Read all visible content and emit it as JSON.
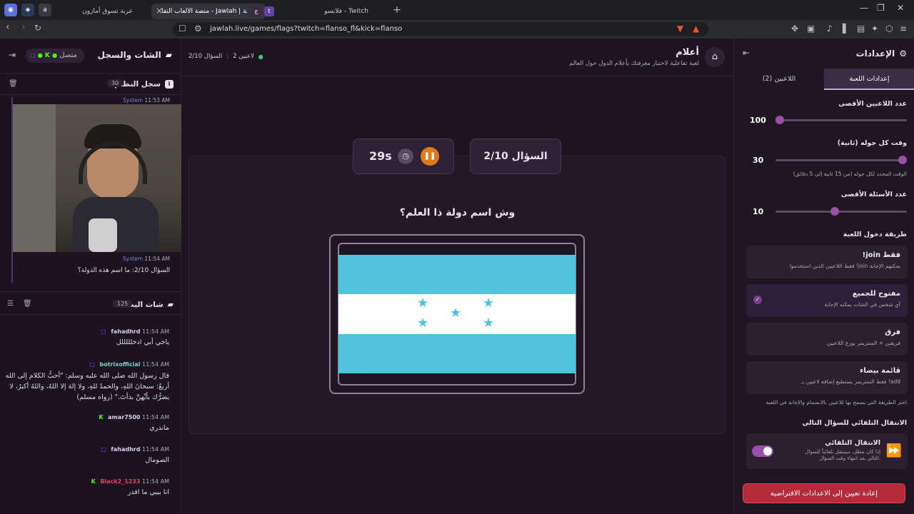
{
  "browser": {
    "tabs": [
      {
        "title": "عربة تسوق أمازون",
        "fav": "a"
      },
      {
        "title": "منصة الألعاب التفا - Jawlah | جولة",
        "fav": "ج"
      },
      {
        "title": "فلانسو - Twitch",
        "fav": "t"
      }
    ],
    "url": "jawlah.live/games/flags?twitch=flanso_fl&kick=flanso",
    "new_tab": "+"
  },
  "left_panel": {
    "title": "الشات والسجل",
    "status": "متصل",
    "system_log": {
      "title": "سجل النظام",
      "count": "30"
    },
    "log_entries": [
      {
        "time": "11:53 AM",
        "sender": "System",
        "text": ""
      },
      {
        "time": "11:54 AM",
        "sender": "System",
        "text": "السؤال 2/10: ما اسم هذه الدولة؟"
      }
    ],
    "chat": {
      "title": "شات البث",
      "count": "125",
      "messages": [
        {
          "time": "11:54 AM",
          "user": "fahadhrd",
          "color": "#d8d0f0",
          "platform": "twitch",
          "text": "ياخي أبي ادخلللللل"
        },
        {
          "time": "11:54 AM",
          "user": "botrixofficial",
          "color": "#7bd0d0",
          "platform": "twitch",
          "text": "قال رسول الله صلى الله عليه وسلم: \"أحبُّ الكلام إلى الله أربعٌ: سبحانَ اللهِ، والحمدُ للهِ، ولا إلهَ إلا اللهُ، واللهُ أكبرُ، لا يضرُّك بأيِّهنَّ بدأتَ.\" (رواه مسلم)"
        },
        {
          "time": "11:54 AM",
          "user": "amar7500",
          "color": "#d8d0f0",
          "platform": "kick",
          "text": "ماندري"
        },
        {
          "time": "11:54 AM",
          "user": "fahadhrd",
          "color": "#d8d0f0",
          "platform": "twitch",
          "text": "الصومال"
        },
        {
          "time": "11:54 AM",
          "user": "Black2_1233",
          "color": "#e04060",
          "platform": "kick",
          "text": "انا بيبي ما اقدر"
        }
      ]
    }
  },
  "game": {
    "title": "أعلام",
    "subtitle": "لعبة تفاعلية لاختبار معرفتك بأعلام الدول حول العالم",
    "players_text": "2 لاعبين",
    "question_text": "السؤال 2/10",
    "question_box": "السؤال 2/10",
    "timer": "29s",
    "prompt": "وش اسم دولة ذا العلم؟",
    "flag": {
      "stripe_color": "#4fc3dc",
      "center_color": "#ffffff",
      "star_color": "#4fc3dc",
      "stars": 5
    }
  },
  "settings": {
    "title": "الإعدادات",
    "tabs": [
      {
        "label": "اللاعبين (2)",
        "active": false
      },
      {
        "label": "إعدادات اللعبة",
        "active": true
      }
    ],
    "max_players": {
      "label": "عدد اللاعبين الأقصى",
      "value": "100",
      "fraction": 0.0
    },
    "round_time": {
      "label": "وقت كل جوله (ثانية)",
      "value": "30",
      "fraction": 1.0,
      "hint": "الوقت المحدد لكل جوله (من 15 ثانية إلى 5 دقائق)"
    },
    "max_questions": {
      "label": "عدد الأسئلة الأقصى",
      "value": "10",
      "fraction": 0.45
    },
    "entry_method": {
      "label": "طريقة دخول اللعبة",
      "options": [
        {
          "title": "!join فقط",
          "desc": "فقط اللاعبين الذين استخدموا !join يمكنهم الإجابة",
          "selected": false
        },
        {
          "title": "مفتوح للجميع",
          "desc": "أي شخص في الشات يمكنه الإجابة",
          "selected": true
        },
        {
          "title": "فرق",
          "desc": "فريقين + الستريمر يوزع اللاعبين",
          "selected": false
        },
        {
          "title": "قائمة بيضاء",
          "desc": "فقط الستريمر يستطيع إضافة لاعبين بـ !add",
          "selected": false
        }
      ],
      "hint": "اختر الطريقة التي يسمح بها للاعبين بالانضمام والإجابة في اللعبة"
    },
    "auto_next": {
      "section_label": "الانتقال التلقائي للسؤال التالي",
      "title": "الانتقال التلقائي",
      "desc": "إذا كان مفعّل، سينتقل تلقائياً للسؤال التالي بعد انتهاء وقت السؤال.",
      "enabled": true
    },
    "reset_button": "إعادة تعيين إلى الاعدادات الافتراضية"
  }
}
